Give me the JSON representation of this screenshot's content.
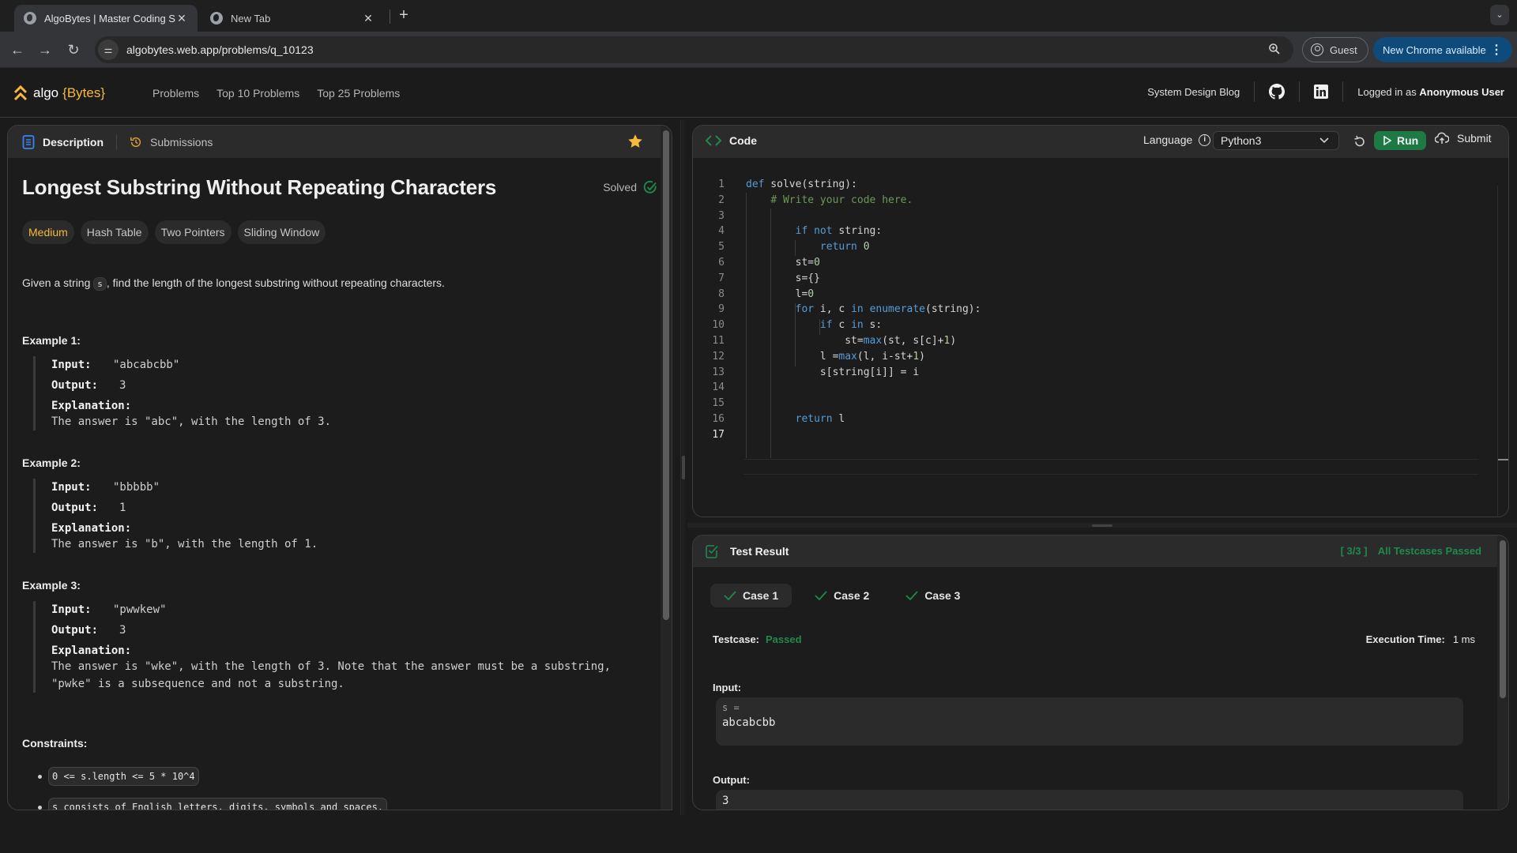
{
  "browser": {
    "tabs": [
      {
        "title": "AlgoBytes | Master Coding Sk",
        "active": true
      },
      {
        "title": "New Tab",
        "active": false
      }
    ],
    "url": "algobytes.web.app/problems/q_10123",
    "profile_label": "Guest",
    "update_label": "New Chrome available"
  },
  "header": {
    "logo_prefix": "algo",
    "logo_brand": "{Bytes}",
    "nav": [
      "Problems",
      "Top 10 Problems",
      "Top 25 Problems"
    ],
    "blog_link": "System Design Blog",
    "logged_in_prefix": "Logged in as",
    "user_name": "Anonymous User"
  },
  "problem_panel": {
    "tabs": [
      {
        "label": "Description",
        "icon": "book-icon",
        "active": true
      },
      {
        "label": "Submissions",
        "icon": "history-icon",
        "active": false
      }
    ],
    "favorite": true,
    "title": "Longest Substring Without Repeating Characters",
    "status": "Solved",
    "tags": [
      {
        "label": "Medium",
        "kind": "difficulty"
      },
      {
        "label": "Hash Table",
        "kind": "topic"
      },
      {
        "label": "Two Pointers",
        "kind": "topic"
      },
      {
        "label": "Sliding Window",
        "kind": "topic"
      }
    ],
    "description": {
      "before": "Given a string ",
      "code": "s",
      "after": ", find the length of the longest substring without repeating characters."
    },
    "examples": [
      {
        "heading": "Example 1:",
        "input_label": "Input:",
        "input": "\"abcabcbb\"",
        "output_label": "Output:",
        "output": "3",
        "explanation_label": "Explanation:",
        "explanation": [
          "The answer is \"abc\", with the length of 3."
        ]
      },
      {
        "heading": "Example 2:",
        "input_label": "Input:",
        "input": "\"bbbbb\"",
        "output_label": "Output:",
        "output": "1",
        "explanation_label": "Explanation:",
        "explanation": [
          "The answer is \"b\", with the length of 1."
        ]
      },
      {
        "heading": "Example 3:",
        "input_label": "Input:",
        "input": "\"pwwkew\"",
        "output_label": "Output:",
        "output": "3",
        "explanation_label": "Explanation:",
        "explanation": [
          "The answer is \"wke\", with the length of 3. Note that the answer must be a substring,",
          "\"pwke\" is a subsequence and not a substring."
        ]
      }
    ],
    "constraints_heading": "Constraints:",
    "constraints": [
      "0 <= s.length <= 5 * 10^4",
      "s consists of English letters, digits, symbols and spaces."
    ]
  },
  "code_panel": {
    "title": "Code",
    "language_label": "Language",
    "language": "Python3",
    "run_label": "Run",
    "submit_label": "Submit",
    "current_line": 17,
    "lines": [
      [
        [
          "kw",
          "def"
        ],
        [
          "t",
          " solve(string):"
        ]
      ],
      [
        [
          "t",
          "    "
        ],
        [
          "cm",
          "# Write your code here."
        ]
      ],
      [
        [
          "t",
          ""
        ]
      ],
      [
        [
          "t",
          "        "
        ],
        [
          "kw",
          "if"
        ],
        [
          "t",
          " "
        ],
        [
          "kw",
          "not"
        ],
        [
          "t",
          " string:"
        ]
      ],
      [
        [
          "t",
          "            "
        ],
        [
          "kw",
          "return"
        ],
        [
          "t",
          " "
        ],
        [
          "nm",
          "0"
        ]
      ],
      [
        [
          "t",
          "        st="
        ],
        [
          "nm",
          "0"
        ]
      ],
      [
        [
          "t",
          "        s={}"
        ]
      ],
      [
        [
          "t",
          "        l="
        ],
        [
          "nm",
          "0"
        ]
      ],
      [
        [
          "t",
          "        "
        ],
        [
          "kw",
          "for"
        ],
        [
          "t",
          " i, c "
        ],
        [
          "kw",
          "in"
        ],
        [
          "t",
          " "
        ],
        [
          "kw",
          "enumerate"
        ],
        [
          "t",
          "(string):"
        ]
      ],
      [
        [
          "t",
          "            "
        ],
        [
          "kw",
          "if"
        ],
        [
          "t",
          " c "
        ],
        [
          "kw",
          "in"
        ],
        [
          "t",
          " s:"
        ]
      ],
      [
        [
          "t",
          "                st="
        ],
        [
          "kw",
          "max"
        ],
        [
          "t",
          "(st, s[c]+"
        ],
        [
          "nm",
          "1"
        ],
        [
          "t",
          ")"
        ]
      ],
      [
        [
          "t",
          "            l ="
        ],
        [
          "kw",
          "max"
        ],
        [
          "t",
          "(l, i-st+"
        ],
        [
          "nm",
          "1"
        ],
        [
          "t",
          ")"
        ]
      ],
      [
        [
          "t",
          "            s[string[i]] = i"
        ]
      ],
      [
        [
          "t",
          ""
        ]
      ],
      [
        [
          "t",
          ""
        ]
      ],
      [
        [
          "t",
          "        "
        ],
        [
          "kw",
          "return"
        ],
        [
          "t",
          " l"
        ]
      ],
      [
        [
          "t",
          ""
        ]
      ]
    ]
  },
  "test_panel": {
    "title": "Test Result",
    "passed_count": "[ 3/3 ]",
    "summary": "All Testcases Passed",
    "cases": [
      {
        "label": "Case 1",
        "passed": true,
        "active": true
      },
      {
        "label": "Case 2",
        "passed": true,
        "active": false
      },
      {
        "label": "Case 3",
        "passed": true,
        "active": false
      }
    ],
    "testcase_label": "Testcase:",
    "testcase_status": "Passed",
    "exec_label": "Execution Time:",
    "exec_value": "1 ms",
    "input_label": "Input:",
    "input_var": "s =",
    "input_value": "abcabcbb",
    "output_label": "Output:",
    "output_value": "3"
  },
  "colors": {
    "accent_yellow": "#f6b93b",
    "success_green": "#1e8a4c",
    "run_green": "#1e7a45",
    "link_blue": "#0e4a7a"
  }
}
